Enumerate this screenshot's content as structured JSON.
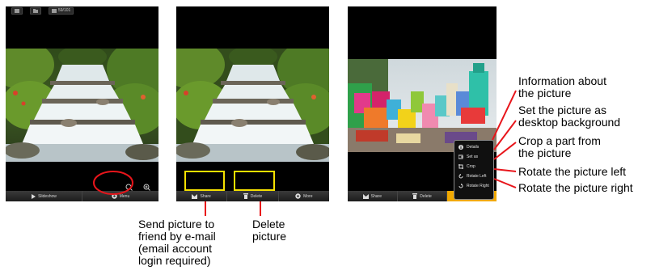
{
  "screen1": {
    "status": {
      "counter": "59/101"
    },
    "bottombar": {
      "slideshow_label": "Slideshow",
      "menu_label": "Menu"
    }
  },
  "screen2": {
    "bottombar": {
      "share_label": "Share",
      "delete_label": "Delete",
      "more_label": "More"
    }
  },
  "screen3": {
    "bottombar": {
      "share_label": "Share",
      "delete_label": "Delete"
    },
    "menu": {
      "items": [
        {
          "label": "Details",
          "icon": "info-icon"
        },
        {
          "label": "Set as",
          "icon": "set-as-icon"
        },
        {
          "label": "Crop",
          "icon": "crop-icon"
        },
        {
          "label": "Rotate Left",
          "icon": "rotate-left-icon"
        },
        {
          "label": "Rotate Right",
          "icon": "rotate-right-icon"
        }
      ]
    }
  },
  "annotations": {
    "share": [
      "Send picture to",
      "friend by e-mail",
      "(email account",
      "login required)"
    ],
    "delete": [
      "Delete",
      "picture"
    ],
    "details": [
      "Information about",
      "the picture"
    ],
    "set_as": [
      "Set the picture as",
      "desktop background"
    ],
    "crop": [
      "Crop a part from",
      "the picture"
    ],
    "rotate_left": "Rotate the picture left",
    "rotate_right": "Rotate the picture right"
  },
  "colors": {
    "annotation_red": "#e8151b",
    "highlight_yellow": "#f5e000",
    "menu_button_orange": "#f0a800"
  }
}
